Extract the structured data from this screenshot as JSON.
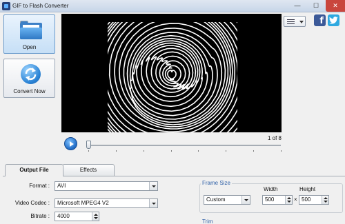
{
  "window": {
    "title": "GIF to Flash Converter",
    "minimize_glyph": "—",
    "maximize_glyph": "☐",
    "close_glyph": "✕"
  },
  "sidebar": {
    "open_label": "Open",
    "convert_label": "Convert Now",
    "open_icon": "folder-icon",
    "convert_icon": "refresh-icon"
  },
  "toolbar": {
    "view_icon": "list-view-icon",
    "facebook_letter": "f",
    "facebook_icon": "facebook-icon",
    "twitter_icon": "twitter-icon"
  },
  "player": {
    "frame_text": "1 of 8",
    "current_frame": 1,
    "total_frames": 8,
    "progress": 0.0
  },
  "tabs": [
    {
      "label": "Output File",
      "active": true
    },
    {
      "label": "Effects",
      "active": false
    }
  ],
  "output": {
    "format_label": "Format :",
    "format_value": "AVI",
    "codec_label": "Video Codec :",
    "codec_value": "Microsoft MPEG4 V2",
    "bitrate_label": "Bitrate :",
    "bitrate_value": "4000"
  },
  "frame_size": {
    "title": "Frame Size",
    "width_label": "Width",
    "height_label": "Height",
    "preset_value": "Custom",
    "width_value": "500",
    "height_value": "500",
    "times": "×"
  },
  "trim": {
    "title": "Trim"
  },
  "colors": {
    "accent_blue": "#2d5fa6",
    "facebook": "#3b5998",
    "twitter": "#2fa9e0",
    "close_red": "#c9463d"
  }
}
